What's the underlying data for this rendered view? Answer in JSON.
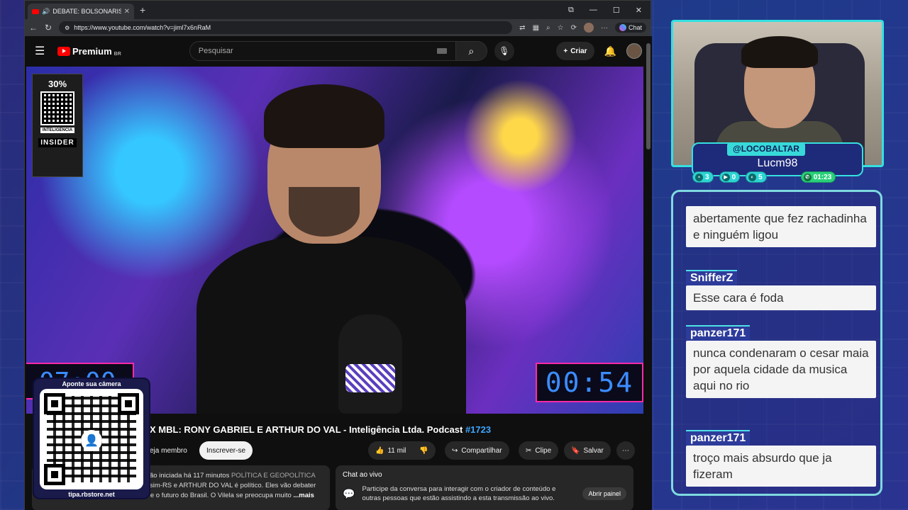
{
  "browser": {
    "tab_title": "DEBATE: BOLSONARISTA X M",
    "tab_close": "✕",
    "new_tab": "+",
    "url": "https://www.youtube.com/watch?v=jiml7x6nRaM",
    "chat_label": "Chat"
  },
  "youtube": {
    "logo_text": "Premium",
    "region": "BR",
    "search_placeholder": "Pesquisar",
    "create_label": "Criar",
    "video_title_main": "X MBL: RONY GABRIEL E ARTHUR DO VAL - Inteligência Ltda. Podcast ",
    "video_title_hash": "#1723",
    "join_label": "eja membro",
    "subscribe_label": "Inscrever-se",
    "likes": "11 mil",
    "share_label": "Compartilhar",
    "clip_label": "Clipe",
    "save_label": "Salvar",
    "desc_line1": "ão iniciada há 117 minutos",
    "desc_tag": "POLÍTICA E GEOPOLÍTICA",
    "desc_line2": "sim-RS e ARTHUR DO VAL é político. Eles vão debater",
    "desc_line3": "sobre Bolsonaro, a política da direita e o futuro do Brasil. O Vilela se preocupa muito",
    "desc_more": "...mais",
    "chatlive_title": "Chat ao vivo",
    "chatlive_text": "Participe da conversa para interagir com o criador de conteúdo e outras pessoas que estão assistindo a esta transmissão ao vivo.",
    "chatlive_button": "Abrir painel"
  },
  "video": {
    "ad_pct": "30%",
    "ad_chip": "INTELIGENCIA",
    "ad_brand": "INSIDER",
    "timer_left": "07:00",
    "timer_right": "00:54"
  },
  "stream": {
    "qr_top": "Aponte sua câmera",
    "qr_bottom": "tipa.rbstore.net",
    "handle": "@LOCOBALTAR",
    "display_name": "Lucm98",
    "stat_chat": "3",
    "stat_yt": "0",
    "stat_other": "5",
    "stat_time": "01:23"
  },
  "chat": {
    "messages": [
      {
        "user": "",
        "text": "abertamente que fez rachadinha e ninguém ligou"
      },
      {
        "user": "SnifferZ",
        "text": "Esse cara é foda"
      },
      {
        "user": "panzer171",
        "text": "nunca condenaram o cesar maia por aquela cidade da musica aqui no rio"
      },
      {
        "user": "panzer171",
        "text": "troço mais absurdo que ja fizeram"
      }
    ]
  },
  "colors": {
    "accent_cyan": "#35e0e0",
    "timer_border": "#ff2aa6",
    "timer_digits": "#3b8cff",
    "yt_red": "#ff0000"
  }
}
